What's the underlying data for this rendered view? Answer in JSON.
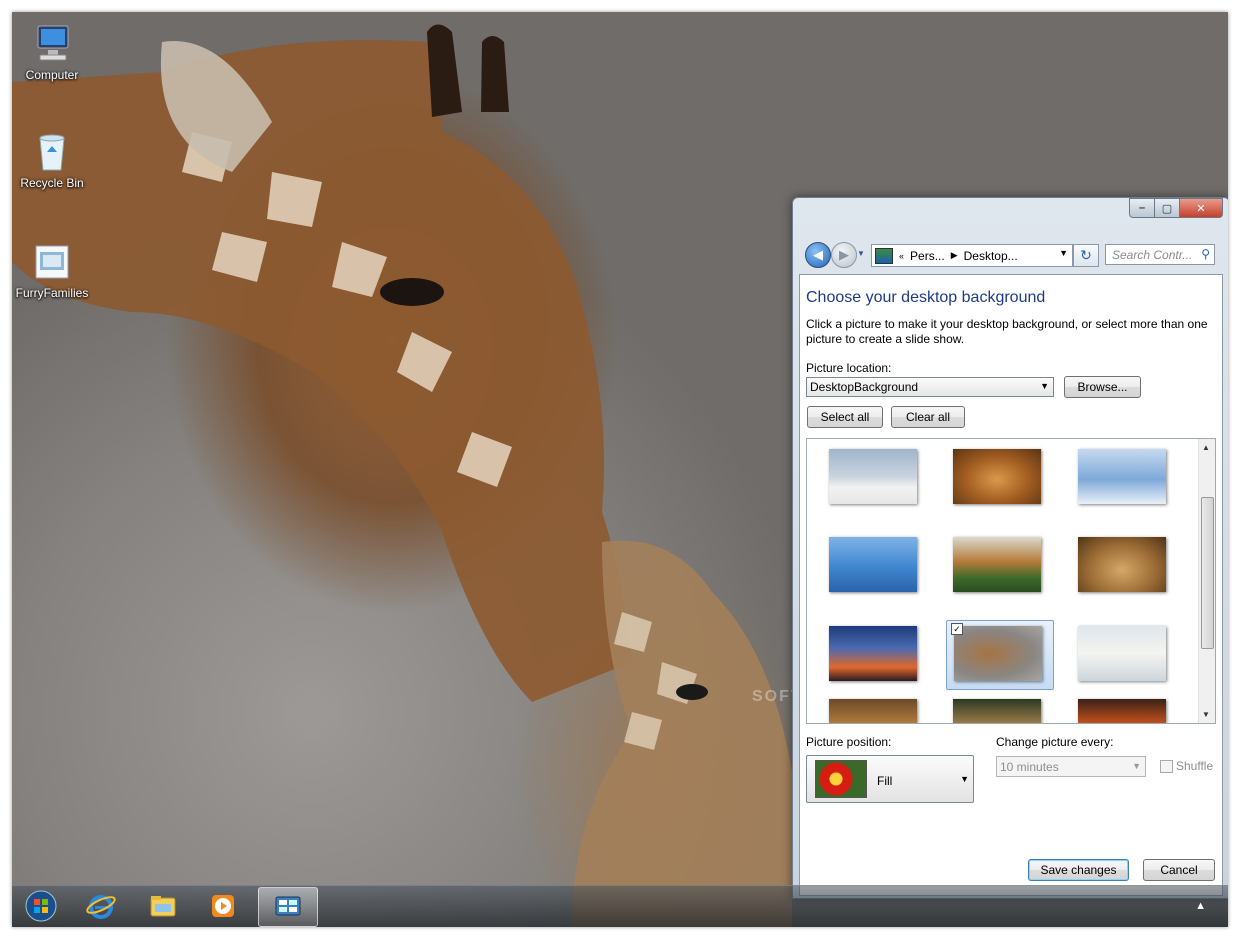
{
  "desktop": {
    "icons": [
      {
        "label": "Computer"
      },
      {
        "label": "Recycle Bin"
      },
      {
        "label": "FurryFamilies"
      }
    ]
  },
  "window": {
    "address": {
      "crumbs": [
        "Pers...",
        "Desktop..."
      ],
      "search_placeholder": "Search Contr..."
    },
    "title": "Choose your desktop background",
    "description": "Click a picture to make it your desktop background, or select more than one picture to create a slide show.",
    "picture_location_label": "Picture location:",
    "picture_location_value": "DesktopBackground",
    "browse_label": "Browse...",
    "select_all_label": "Select all",
    "clear_all_label": "Clear all",
    "picture_position_label": "Picture position:",
    "picture_position_value": "Fill",
    "change_picture_label": "Change picture every:",
    "change_picture_value": "10 minutes",
    "shuffle_label": "Shuffle",
    "save_label": "Save changes",
    "cancel_label": "Cancel"
  },
  "watermark": "SOFTPEDIA"
}
